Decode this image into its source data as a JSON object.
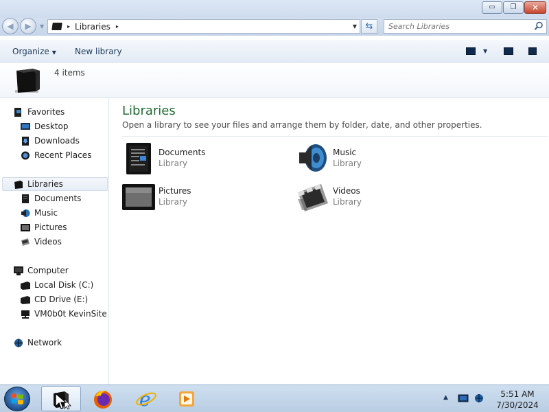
{
  "window": {
    "caption_buttons": {
      "minimize": "▭",
      "maximize": "❐",
      "close": "✕"
    }
  },
  "address_bar": {
    "path_item": "Libraries",
    "separator": "▸",
    "search_placeholder": "Search Libraries"
  },
  "toolbar": {
    "organize_label": "Organize",
    "new_library_label": "New library",
    "caret": "▼"
  },
  "details": {
    "item_count": "4 items"
  },
  "nav_pane": {
    "favorites": {
      "label": "Favorites",
      "items": [
        "Desktop",
        "Downloads",
        "Recent Places"
      ]
    },
    "libraries": {
      "label": "Libraries",
      "items": [
        "Documents",
        "Music",
        "Pictures",
        "Videos"
      ]
    },
    "computer": {
      "label": "Computer",
      "items": [
        "Local Disk (C:)",
        "CD Drive (E:)",
        "VM0b0t KevinSite"
      ]
    },
    "network": {
      "label": "Network"
    }
  },
  "content": {
    "title": "Libraries",
    "description": "Open a library to see your files and arrange them by folder, date, and other properties.",
    "libraries": [
      {
        "name": "Documents",
        "type": "Library",
        "icon": "documents-library-icon"
      },
      {
        "name": "Music",
        "type": "Library",
        "icon": "music-library-icon"
      },
      {
        "name": "Pictures",
        "type": "Library",
        "icon": "pictures-library-icon"
      },
      {
        "name": "Videos",
        "type": "Library",
        "icon": "videos-library-icon"
      }
    ]
  },
  "taskbar": {
    "pinned": [
      "windows-explorer-icon",
      "firefox-icon",
      "internet-explorer-icon",
      "media-player-icon"
    ],
    "tray_arrow": "▲",
    "time": "5:51 AM",
    "date": "7/30/2024"
  },
  "colors": {
    "content_title": "#1f6b2f",
    "link_text": "#1e395b",
    "taskbar_bg": "#c4d6ea",
    "close_button": "#c7462f"
  }
}
